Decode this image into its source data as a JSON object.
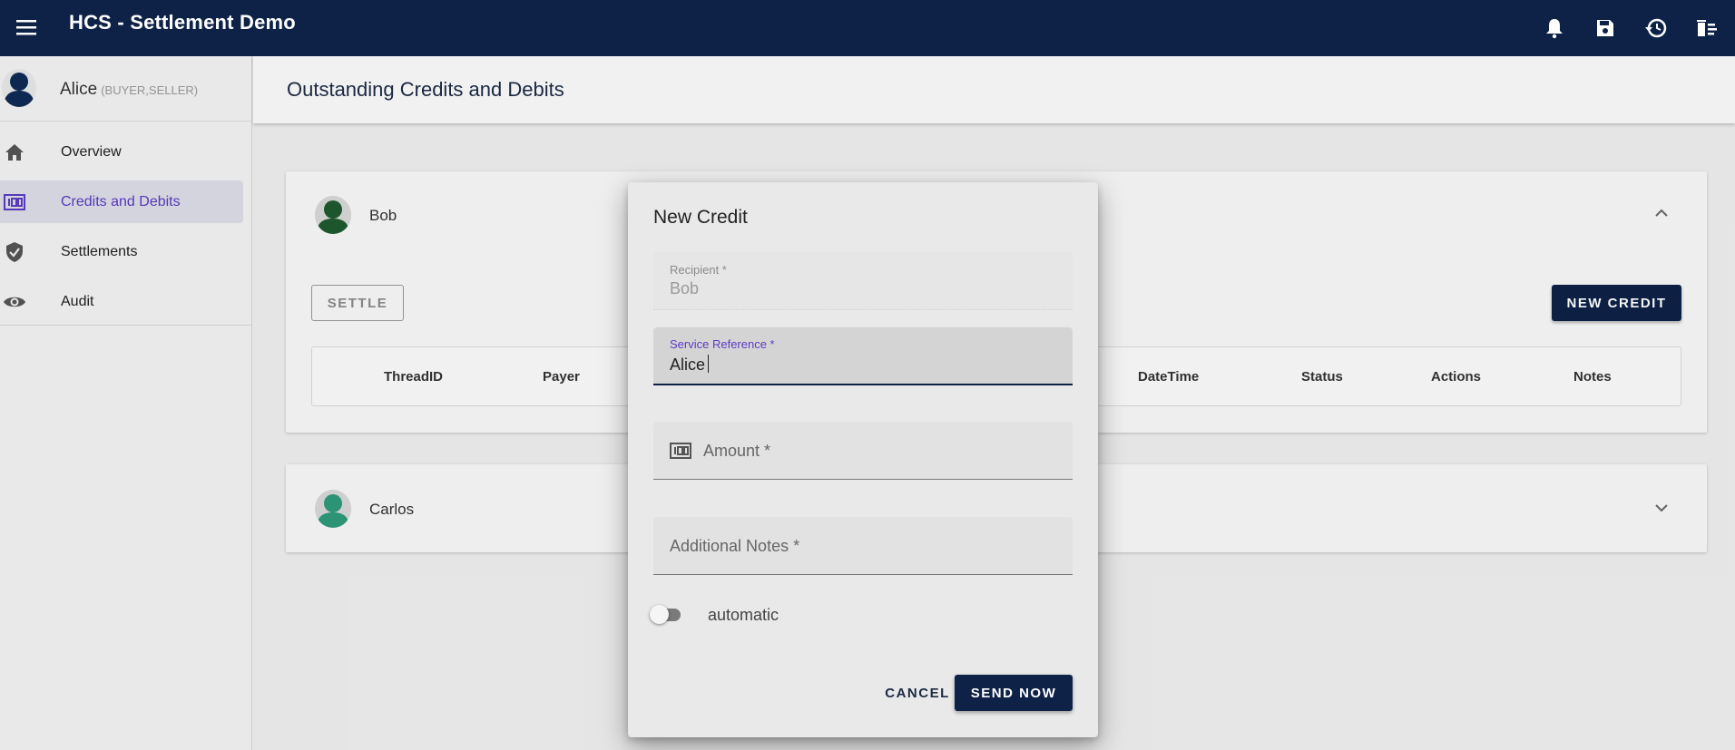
{
  "app": {
    "title": "HCS - Settlement Demo",
    "icons": [
      "menu-icon",
      "bell-icon",
      "save-icon",
      "history-icon",
      "delete-sweep-icon"
    ]
  },
  "user": {
    "name": "Alice",
    "roles": "(BUYER,SELLER)"
  },
  "sidebar": {
    "items": [
      {
        "label": "Overview",
        "icon": "home-icon",
        "active": false
      },
      {
        "label": "Credits and Debits",
        "icon": "money-icon",
        "active": true
      },
      {
        "label": "Settlements",
        "icon": "shield-check-icon",
        "active": false
      },
      {
        "label": "Audit",
        "icon": "eye-icon",
        "active": false
      }
    ]
  },
  "page": {
    "title": "Outstanding Credits and Debits"
  },
  "panels": {
    "bob": {
      "name": "Bob",
      "settle_label": "SETTLE",
      "new_credit_label": "NEW CREDIT",
      "columns": [
        "ThreadID",
        "Payer",
        "DateTime",
        "Status",
        "Actions",
        "Notes"
      ]
    },
    "carlos": {
      "name": "Carlos"
    }
  },
  "dialog": {
    "title": "New Credit",
    "recipient": {
      "label": "Recipient *",
      "value": "Bob"
    },
    "service_reference": {
      "label": "Service Reference *",
      "value": "Alice"
    },
    "amount": {
      "placeholder": "Amount *"
    },
    "notes": {
      "placeholder": "Additional Notes *"
    },
    "toggle": {
      "label": "automatic",
      "checked": false
    },
    "cancel_label": "CANCEL",
    "send_label": "SEND NOW"
  },
  "colors": {
    "primary": "#0e2247",
    "accent": "#5b3bc4"
  }
}
